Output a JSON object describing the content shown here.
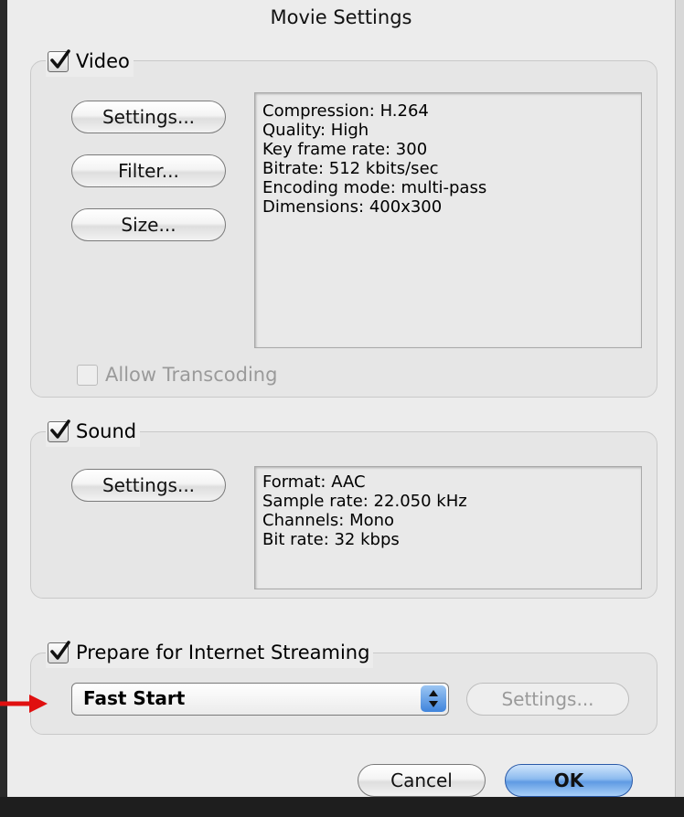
{
  "dialog": {
    "title": "Movie Settings"
  },
  "video": {
    "label": "Video",
    "checked": true,
    "buttons": {
      "settings": "Settings...",
      "filter": "Filter...",
      "size": "Size..."
    },
    "info": [
      "Compression: H.264",
      "Quality: High",
      "Key frame rate: 300",
      "Bitrate: 512 kbits/sec",
      "Encoding mode: multi-pass",
      "Dimensions: 400x300"
    ],
    "allow_transcoding": {
      "label": "Allow Transcoding",
      "checked": false,
      "enabled": false
    }
  },
  "sound": {
    "label": "Sound",
    "checked": true,
    "buttons": {
      "settings": "Settings..."
    },
    "info": [
      "Format: AAC",
      "Sample rate: 22.050 kHz",
      "Channels: Mono",
      "Bit rate: 32 kbps"
    ]
  },
  "streaming": {
    "label": "Prepare for Internet Streaming",
    "checked": true,
    "selected_option": "Fast Start",
    "settings_label": "Settings...",
    "settings_enabled": false
  },
  "footer": {
    "cancel_label": "Cancel",
    "ok_label": "OK"
  },
  "colors": {
    "indicator_arrow": "#e01010",
    "default_button": "#5f9be3"
  }
}
